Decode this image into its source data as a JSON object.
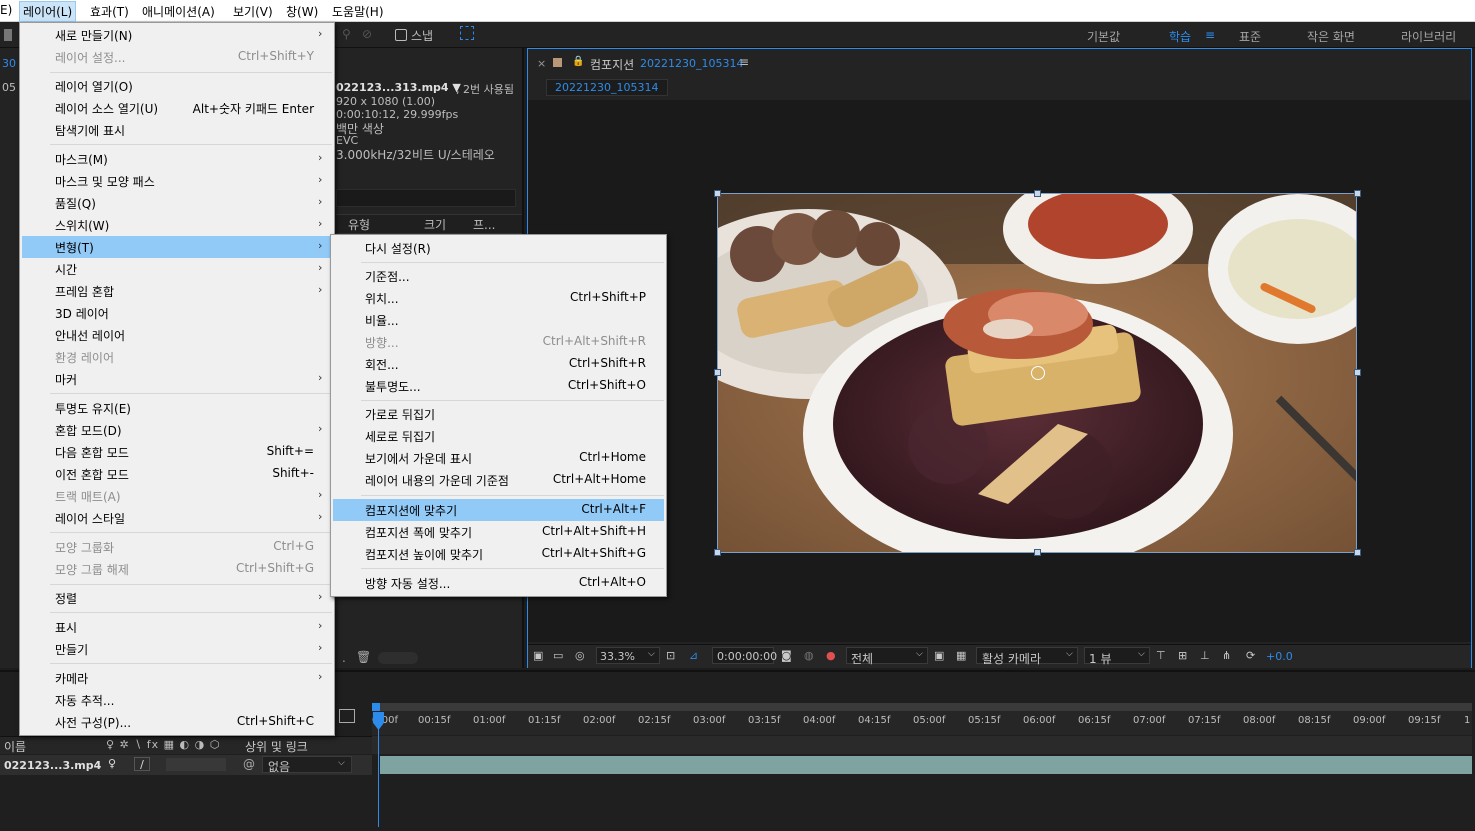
{
  "menubar": {
    "items": [
      "레이어(L)",
      "효과(T)",
      "애니메이션(A)",
      "보기(V)",
      "창(W)",
      "도움말(H)"
    ],
    "cut_item": "E)"
  },
  "toolbar": {
    "snap_label": "스냅",
    "workspaces": [
      "기본값",
      "학습",
      "표준",
      "작은 화면",
      "라이브러리"
    ],
    "active_workspace": "학습"
  },
  "project": {
    "left_cut": [
      "30",
      "05"
    ],
    "file_name": "022123...313.mp4 ▼",
    "used": ", 2번 사용됨",
    "resolution": "920 x 1080 (1.00)",
    "duration": "0:00:10:12, 29.999fps",
    "color": "백만 색상",
    "codec": "EVC",
    "audio": "3.000kHz/32비트 U/스테레오",
    "col_type": "유형",
    "col_size": "크기",
    "col_fr": "프..."
  },
  "viewer": {
    "tab_label": "컴포지션",
    "tab_name": "20221230_105314",
    "sub_tab": "20221230_105314",
    "zoom": "33.3%",
    "timecode": "0:00:00:00",
    "resolution": "전체",
    "camera": "활성 카메라",
    "views": "1 뷰",
    "exposure": "+0.0"
  },
  "timeline": {
    "ruler": [
      "0:00f",
      "00:15f",
      "01:00f",
      "01:15f",
      "02:00f",
      "02:15f",
      "03:00f",
      "03:15f",
      "04:00f",
      "04:15f",
      "05:00f",
      "05:15f",
      "06:00f",
      "06:15f",
      "07:00f",
      "07:15f",
      "08:00f",
      "08:15f",
      "09:00f",
      "09:15f",
      "1"
    ],
    "col_name": "이름",
    "col_parent": "상위 및 링크",
    "layer_name": "022123...3.mp4",
    "parent_value": "없음"
  },
  "layer_menu": {
    "items": [
      {
        "label": "새로 만들기(N)",
        "shortcut": "",
        "sub": true,
        "disabled": false
      },
      {
        "label": "레이어 설정...",
        "shortcut": "Ctrl+Shift+Y",
        "sub": false,
        "disabled": true
      },
      {
        "label": "레이어 열기(O)",
        "shortcut": "",
        "sub": false,
        "disabled": false
      },
      {
        "label": "레이어 소스 열기(U)",
        "shortcut": "Alt+숫자 키패드 Enter",
        "sub": false,
        "disabled": false
      },
      {
        "label": "탐색기에 표시",
        "shortcut": "",
        "sub": false,
        "disabled": false
      },
      {
        "label": "마스크(M)",
        "shortcut": "",
        "sub": true,
        "disabled": false
      },
      {
        "label": "마스크 및 모양 패스",
        "shortcut": "",
        "sub": true,
        "disabled": false
      },
      {
        "label": "품질(Q)",
        "shortcut": "",
        "sub": true,
        "disabled": false
      },
      {
        "label": "스위치(W)",
        "shortcut": "",
        "sub": true,
        "disabled": false
      },
      {
        "label": "변형(T)",
        "shortcut": "",
        "sub": true,
        "disabled": false
      },
      {
        "label": "시간",
        "shortcut": "",
        "sub": true,
        "disabled": false
      },
      {
        "label": "프레임 혼합",
        "shortcut": "",
        "sub": true,
        "disabled": false
      },
      {
        "label": "3D 레이어",
        "shortcut": "",
        "sub": false,
        "disabled": false
      },
      {
        "label": "안내선 레이어",
        "shortcut": "",
        "sub": false,
        "disabled": false
      },
      {
        "label": "환경 레이어",
        "shortcut": "",
        "sub": false,
        "disabled": true
      },
      {
        "label": "마커",
        "shortcut": "",
        "sub": true,
        "disabled": false
      },
      {
        "label": "투명도 유지(E)",
        "shortcut": "",
        "sub": false,
        "disabled": false
      },
      {
        "label": "혼합 모드(D)",
        "shortcut": "",
        "sub": true,
        "disabled": false
      },
      {
        "label": "다음 혼합 모드",
        "shortcut": "Shift+=",
        "sub": false,
        "disabled": false
      },
      {
        "label": "이전 혼합 모드",
        "shortcut": "Shift+-",
        "sub": false,
        "disabled": false
      },
      {
        "label": "트랙 매트(A)",
        "shortcut": "",
        "sub": true,
        "disabled": true
      },
      {
        "label": "레이어 스타일",
        "shortcut": "",
        "sub": true,
        "disabled": false
      },
      {
        "label": "모양 그룹화",
        "shortcut": "Ctrl+G",
        "sub": false,
        "disabled": true
      },
      {
        "label": "모양 그룹 해제",
        "shortcut": "Ctrl+Shift+G",
        "sub": false,
        "disabled": true
      },
      {
        "label": "정렬",
        "shortcut": "",
        "sub": true,
        "disabled": false
      },
      {
        "label": "표시",
        "shortcut": "",
        "sub": true,
        "disabled": false
      },
      {
        "label": "만들기",
        "shortcut": "",
        "sub": true,
        "disabled": false
      },
      {
        "label": "카메라",
        "shortcut": "",
        "sub": true,
        "disabled": false
      },
      {
        "label": "자동 추적...",
        "shortcut": "",
        "sub": false,
        "disabled": false
      },
      {
        "label": "사전 구성(P)...",
        "shortcut": "Ctrl+Shift+C",
        "sub": false,
        "disabled": false
      }
    ]
  },
  "transform_menu": {
    "items": [
      {
        "label": "다시 설정(R)",
        "shortcut": "",
        "disabled": false
      },
      {
        "label": "기준점...",
        "shortcut": "",
        "disabled": false
      },
      {
        "label": "위치...",
        "shortcut": "Ctrl+Shift+P",
        "disabled": false
      },
      {
        "label": "비율...",
        "shortcut": "",
        "disabled": false
      },
      {
        "label": "방향...",
        "shortcut": "Ctrl+Alt+Shift+R",
        "disabled": true
      },
      {
        "label": "회전...",
        "shortcut": "Ctrl+Shift+R",
        "disabled": false
      },
      {
        "label": "불투명도...",
        "shortcut": "Ctrl+Shift+O",
        "disabled": false
      },
      {
        "label": "가로로 뒤집기",
        "shortcut": "",
        "disabled": false
      },
      {
        "label": "세로로 뒤집기",
        "shortcut": "",
        "disabled": false
      },
      {
        "label": "보기에서 가운데 표시",
        "shortcut": "Ctrl+Home",
        "disabled": false
      },
      {
        "label": "레이어 내용의 가운데 기준점",
        "shortcut": "Ctrl+Alt+Home",
        "disabled": false
      },
      {
        "label": "컴포지션에 맞추기",
        "shortcut": "Ctrl+Alt+F",
        "disabled": false
      },
      {
        "label": "컴포지션 폭에 맞추기",
        "shortcut": "Ctrl+Alt+Shift+H",
        "disabled": false
      },
      {
        "label": "컴포지션 높이에 맞추기",
        "shortcut": "Ctrl+Alt+Shift+G",
        "disabled": false
      },
      {
        "label": "방향 자동 설정...",
        "shortcut": "Ctrl+Alt+O",
        "disabled": false
      }
    ]
  },
  "colors": {
    "accent": "#2d8ceb",
    "menu_highlight": "#91c9f7",
    "panel": "#232323",
    "layer_bar": "#7fa3a0"
  }
}
